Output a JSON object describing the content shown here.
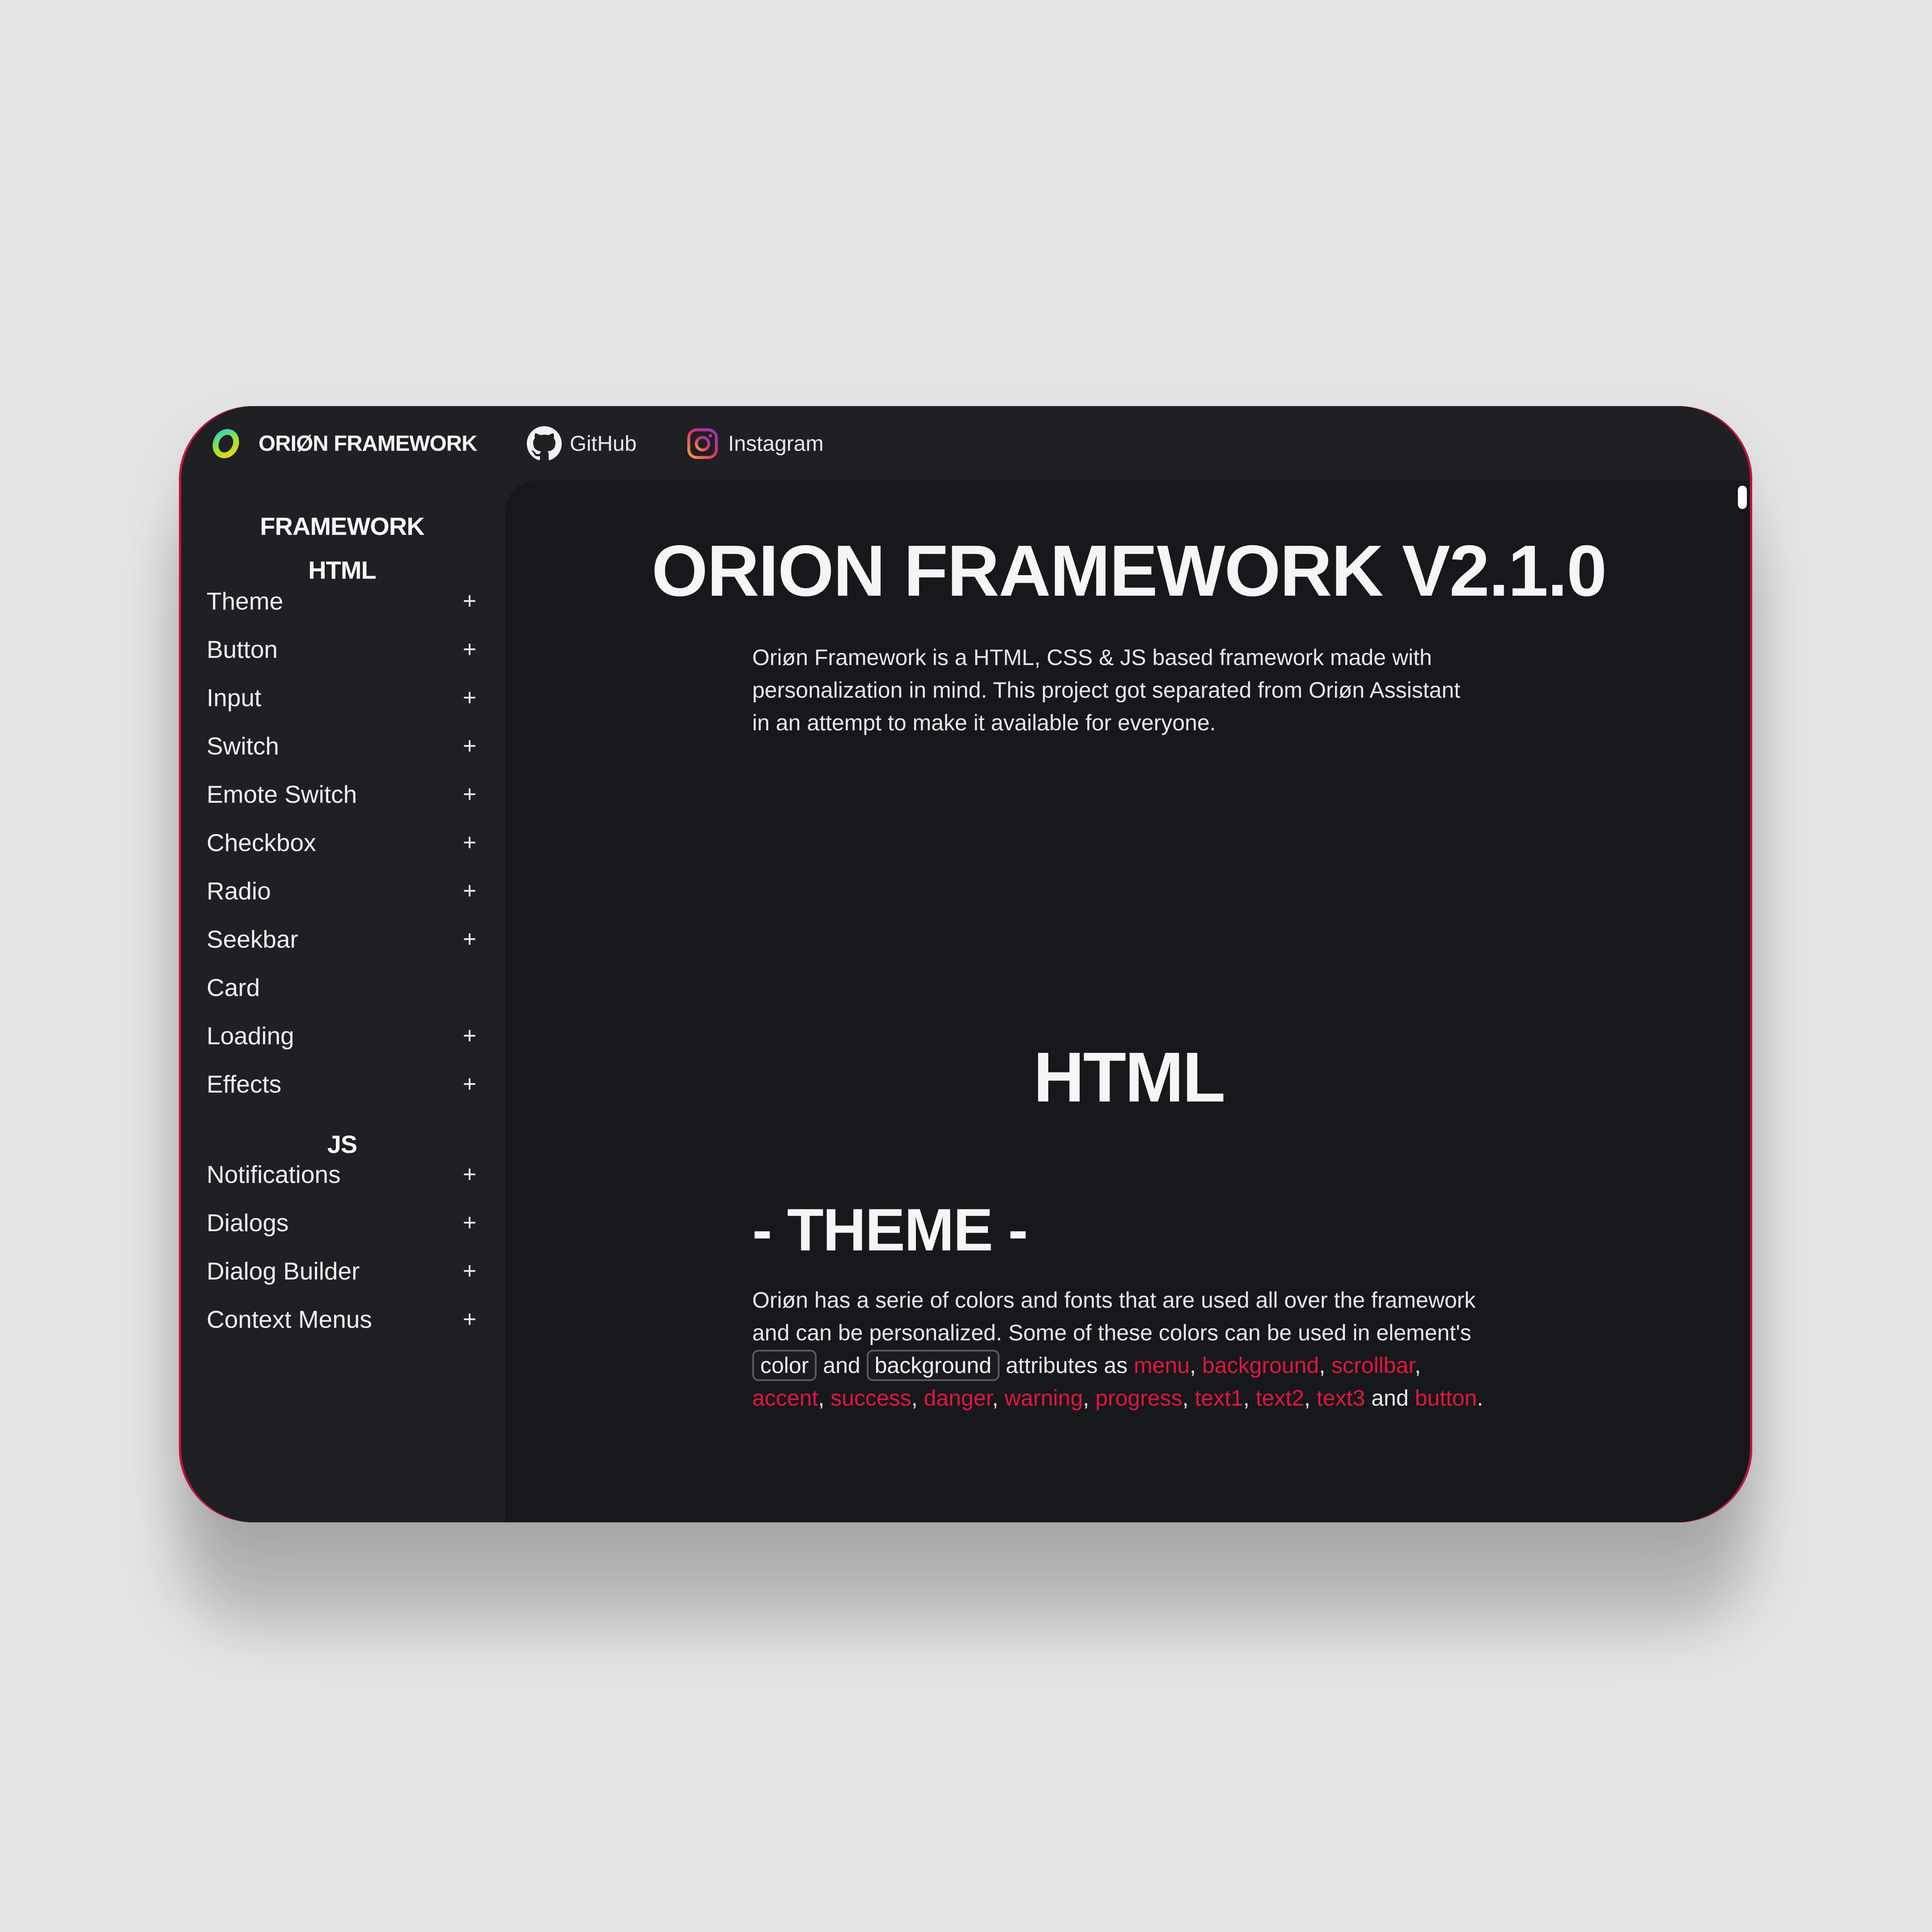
{
  "topbar": {
    "brand": "ORIØN FRAMEWORK",
    "links": [
      {
        "label": "GitHub",
        "icon": "github-icon"
      },
      {
        "label": "Instagram",
        "icon": "instagram-icon"
      }
    ]
  },
  "sidebar": {
    "headings": [
      "FRAMEWORK",
      "HTML",
      "JS"
    ],
    "html_items": [
      {
        "label": "Theme",
        "expand": "+"
      },
      {
        "label": "Button",
        "expand": "+"
      },
      {
        "label": "Input",
        "expand": "+"
      },
      {
        "label": "Switch",
        "expand": "+"
      },
      {
        "label": "Emote Switch",
        "expand": "+"
      },
      {
        "label": "Checkbox",
        "expand": "+"
      },
      {
        "label": "Radio",
        "expand": "+"
      },
      {
        "label": "Seekbar",
        "expand": "+"
      },
      {
        "label": "Card",
        "expand": ""
      },
      {
        "label": "Loading",
        "expand": "+"
      },
      {
        "label": "Effects",
        "expand": "+"
      }
    ],
    "js_items": [
      {
        "label": "Notifications",
        "expand": "+"
      },
      {
        "label": "Dialogs",
        "expand": "+"
      },
      {
        "label": "Dialog Builder",
        "expand": "+"
      },
      {
        "label": "Context Menus",
        "expand": "+"
      }
    ]
  },
  "main": {
    "title": "ORION FRAMEWORK V2.1.0",
    "intro": "Oriøn Framework is a HTML, CSS & JS based framework made with personalization in mind. This project got separated from Oriøn Assistant in an attempt to make it available for everyone.",
    "section_heading": "HTML",
    "theme_heading": "- THEME -",
    "theme_text_1": "Oriøn has a serie of colors and fonts that are used all over the framework and can be personalized. Some of these colors can be used in element's",
    "code_color": "color",
    "word_and": "and",
    "code_background": "background",
    "theme_text_2": "attributes as",
    "color_names": [
      "menu",
      "background",
      "scrollbar",
      "accent",
      "success",
      "danger",
      "warning",
      "progress",
      "text1",
      "text2",
      "text3"
    ],
    "final_and": "and",
    "last_color": "button",
    "period": "."
  },
  "colors": {
    "accent": "#e0173f",
    "window_bg": "#1f2024",
    "content_bg": "#17181c",
    "page_bg": "#e4e4e4"
  }
}
